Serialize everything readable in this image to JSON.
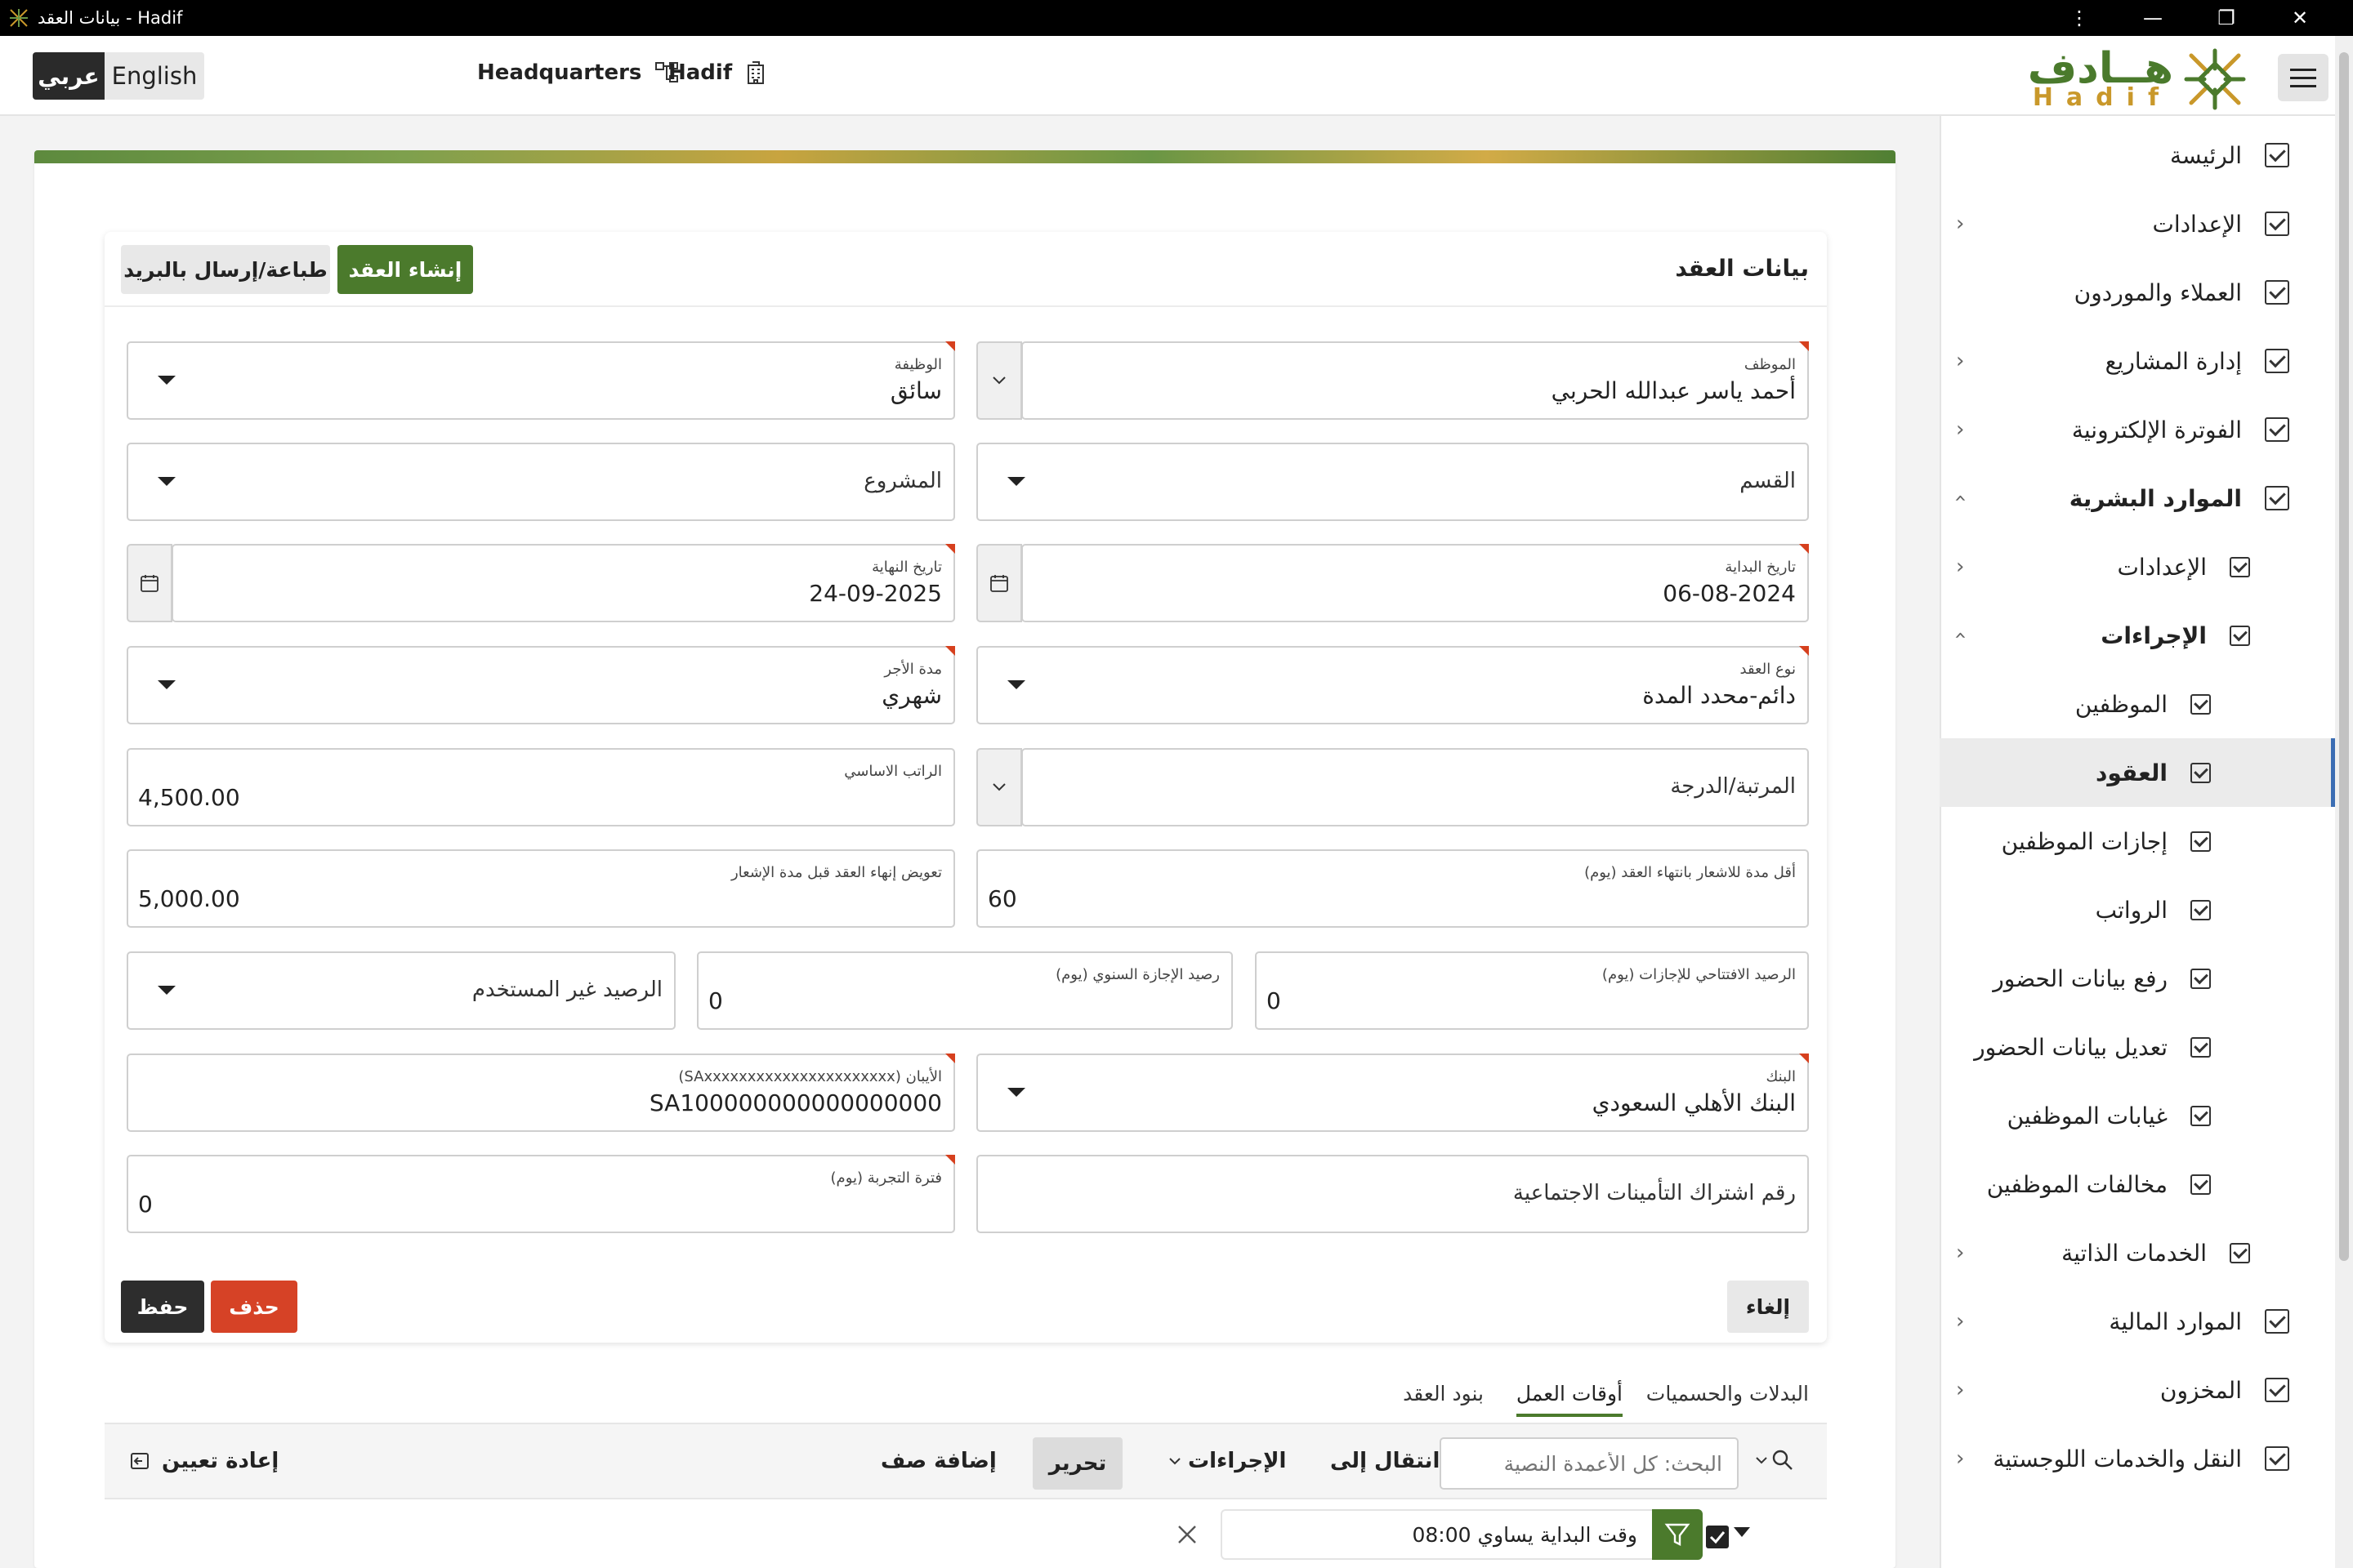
{
  "window": {
    "title": "بيانات العقد - Hadif",
    "controls": [
      "⋮",
      "—",
      "❐",
      "✕"
    ]
  },
  "header": {
    "lang_ar": "عربي",
    "lang_en": "English",
    "headquarters": "Headquarters",
    "org": "Hadif",
    "logo_ar": "هــادف",
    "logo_en": "Hadif"
  },
  "sidebar": {
    "items": [
      {
        "label": "الرئيسة"
      },
      {
        "label": "الإعدادات"
      },
      {
        "label": "العملاء والموردون"
      },
      {
        "label": "إدارة المشاريع"
      },
      {
        "label": "الفوترة الإلكترونية"
      },
      {
        "label": "الموارد البشرية"
      },
      {
        "label": "الإعدادات"
      },
      {
        "label": "الإجراءات"
      },
      {
        "label": "الموظفين"
      },
      {
        "label": "العقود"
      },
      {
        "label": "إجازات الموظفين"
      },
      {
        "label": "الرواتب"
      },
      {
        "label": "رفع بيانات الحضور"
      },
      {
        "label": "تعديل بيانات الحضور"
      },
      {
        "label": "غيابات الموظفين"
      },
      {
        "label": "مخالفات الموظفين"
      },
      {
        "label": "الخدمات الذاتية"
      },
      {
        "label": "الموارد المالية"
      },
      {
        "label": "المخزون"
      },
      {
        "label": "النقل والخدمات اللوجستية"
      }
    ]
  },
  "form": {
    "title": "بيانات العقد",
    "create_button": "إنشاء العقد",
    "print_button": "طباعة/إرسال بالبريد",
    "employee_label": "الموظف",
    "employee_value": "أحمد ياسر عبدالله  الحربي",
    "job_label": "الوظيفة",
    "job_value": "سائق",
    "department_placeholder": "القسم",
    "project_placeholder": "المشروع",
    "start_date_label": "تاريخ البداية",
    "start_date_value": "06-08-2024",
    "end_date_label": "تاريخ النهاية",
    "end_date_value": "24-09-2025",
    "contract_type_label": "نوع العقد",
    "contract_type_value": "دائم-محدد المدة",
    "pay_period_label": "مدة الأجر",
    "pay_period_value": "شهري",
    "grade_placeholder": "المرتبة/الدرجة",
    "basic_salary_label": "الراتب الاساسي",
    "basic_salary_value": "4,500.00",
    "notice_label": "أقل مدة للاشعار بانتهاء العقد (يوم)",
    "notice_value": "60",
    "compensation_label": "تعويض إنهاء العقد قبل مدة الإشعار",
    "compensation_value": "5,000.00",
    "opening_balance_label": "الرصيد الافتتاحي للإجازات (يوم)",
    "opening_balance_value": "0",
    "annual_balance_label": "رصيد الإجازة السنوي (يوم)",
    "annual_balance_value": "0",
    "unused_balance_placeholder": "الرصيد غير المستخدم",
    "bank_label": "البنك",
    "bank_value": "البنك الأهلي السعودي",
    "iban_label": "الأيبان (SAxxxxxxxxxxxxxxxxxxxxxx)",
    "iban_value": "SA100000000000000000",
    "gosi_placeholder": "رقم اشتراك التأمينات الاجتماعية",
    "probation_label": "فترة التجربة (يوم)",
    "probation_value": "0",
    "cancel_button": "إلغاء",
    "delete_button": "حذف",
    "save_button": "حفظ"
  },
  "tabs": [
    "البدلات والحسميات",
    "أوقات العمل",
    "بنود العقد"
  ],
  "toolbar": {
    "search_placeholder": "البحث: كل الأعمدة النصية",
    "goto": "انتقال إلى",
    "actions": "الإجراءات",
    "edit": "تحرير",
    "add_row": "إضافة صف",
    "reset": "إعادة تعيين"
  },
  "filter": {
    "text": "وقت البداية يساوي 08:00"
  },
  "colors": {
    "brand_green": "#4b7a2c",
    "brand_gold": "#c9982a",
    "danger": "#d64226",
    "dark": "#2d2d2d",
    "active_indicator": "#3b6db3"
  }
}
